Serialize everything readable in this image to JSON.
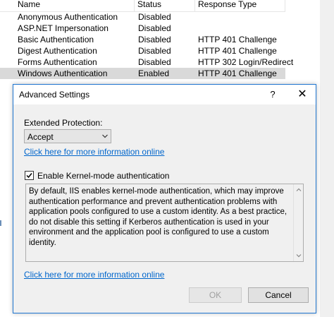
{
  "auth_list": {
    "columns": [
      "Name",
      "Status",
      "Response Type"
    ],
    "rows": [
      {
        "name": "Anonymous Authentication",
        "status": "Disabled",
        "response": ""
      },
      {
        "name": "ASP.NET Impersonation",
        "status": "Disabled",
        "response": ""
      },
      {
        "name": "Basic Authentication",
        "status": "Disabled",
        "response": "HTTP 401 Challenge"
      },
      {
        "name": "Digest Authentication",
        "status": "Disabled",
        "response": "HTTP 401 Challenge"
      },
      {
        "name": "Forms Authentication",
        "status": "Disabled",
        "response": "HTTP 302 Login/Redirect"
      },
      {
        "name": "Windows Authentication",
        "status": "Enabled",
        "response": "HTTP 401 Challenge"
      }
    ]
  },
  "dialog": {
    "title": "Advanced Settings",
    "help_glyph": "?",
    "close_glyph": "✕",
    "extended_protection_label": "Extended Protection:",
    "extended_protection_value": "Accept",
    "info_link_1": "Click here for more information online",
    "kernel_mode_checked": true,
    "kernel_mode_label": "Enable Kernel-mode authentication",
    "description": "By default, IIS enables kernel-mode authentication, which may improve authentication performance and prevent authentication problems with application pools configured to use a custom identity. As a best practice, do not disable this setting if Kerberos authentication is used in your environment and the application pool is configured to use a custom identity.",
    "info_link_2": "Click here for more information online",
    "ok_label": "OK",
    "cancel_label": "Cancel"
  },
  "icons": {
    "dropdown": "chevron-down-icon",
    "checkbox": "checkmark-icon",
    "scroll_up": "scroll-up-arrow-icon",
    "scroll_down": "scroll-down-arrow-icon"
  },
  "colors": {
    "link": "#0066cc",
    "dialog_border": "#1f76d1",
    "selected_row": "#d9d9d9"
  }
}
